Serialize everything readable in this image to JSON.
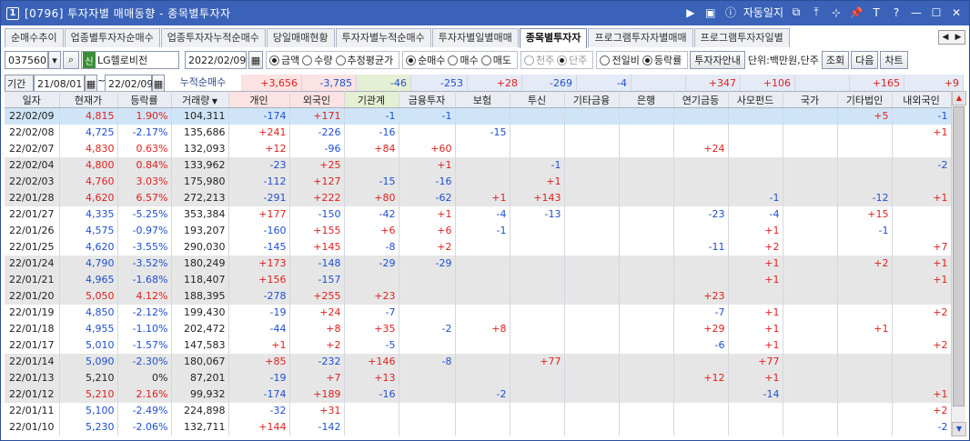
{
  "window": {
    "badge": "1",
    "title": "[0796] 투자자별 매매동향 - 종목별투자자",
    "alarm": "자동일지"
  },
  "tabs": [
    "순매수추이",
    "업종별투자자순매수",
    "업종투자자누적순매수",
    "당일매매현황",
    "투자자별누적순매수",
    "투자자별일별매매",
    "종목별투자자",
    "프로그램투자자별매매",
    "프로그램투자자일별"
  ],
  "active_tab": 6,
  "controls": {
    "code": "037560",
    "stock_name": "LG헬로비전",
    "date": "2022/02/09",
    "r1": [
      "금액",
      "수량",
      "추정평균가"
    ],
    "r2": [
      "순매수",
      "매수",
      "매도"
    ],
    "r3": [
      "천주",
      "단주"
    ],
    "r4": [
      "전일비",
      "등락률"
    ],
    "btn_info": "투자자안내",
    "unit": "단위:백만원,단주",
    "btn_query": "조회",
    "btn_next": "다음",
    "btn_chart": "차트"
  },
  "period": {
    "label": "기간",
    "from": "21/08/01",
    "tilde": "~",
    "to": "22/02/09",
    "cum_label": "누적순매수"
  },
  "summary": [
    "+3,656",
    "-3,785",
    "-46",
    "-253",
    "+28",
    "-269",
    "-4",
    "",
    "+347",
    "+106",
    "",
    "+165",
    "+9"
  ],
  "headers": [
    "일자",
    "현재가",
    "등락률",
    "거래량",
    "개인",
    "외국인",
    "기관계",
    "금융투자",
    "보험",
    "투신",
    "기타금융",
    "은행",
    "연기금등",
    "사모펀드",
    "국가",
    "기타법인",
    "내외국인"
  ],
  "rows": [
    [
      "22/02/09",
      "4,815",
      "1.90%",
      "104,311",
      "-174",
      "+171",
      "-1",
      "-1",
      "",
      "",
      "",
      "",
      "",
      "",
      "",
      "+5",
      "-1"
    ],
    [
      "22/02/08",
      "4,725",
      "-2.17%",
      "135,686",
      "+241",
      "-226",
      "-16",
      "",
      "-15",
      "",
      "",
      "",
      "",
      "",
      "",
      "",
      "+1"
    ],
    [
      "22/02/07",
      "4,830",
      "0.63%",
      "132,093",
      "+12",
      "-96",
      "+84",
      "+60",
      "",
      "",
      "",
      "",
      "+24",
      "",
      "",
      "",
      ""
    ],
    [
      "22/02/04",
      "4,800",
      "0.84%",
      "133,962",
      "-23",
      "+25",
      "",
      "+1",
      "",
      "-1",
      "",
      "",
      "",
      "",
      "",
      "",
      "-2"
    ],
    [
      "22/02/03",
      "4,760",
      "3.03%",
      "175,980",
      "-112",
      "+127",
      "-15",
      "-16",
      "",
      "+1",
      "",
      "",
      "",
      "",
      "",
      "",
      ""
    ],
    [
      "22/01/28",
      "4,620",
      "6.57%",
      "272,213",
      "-291",
      "+222",
      "+80",
      "-62",
      "+1",
      "+143",
      "",
      "",
      "",
      "-1",
      "",
      "-12",
      "+1"
    ],
    [
      "22/01/27",
      "4,335",
      "-5.25%",
      "353,384",
      "+177",
      "-150",
      "-42",
      "+1",
      "-4",
      "-13",
      "",
      "",
      "-23",
      "-4",
      "",
      "+15",
      ""
    ],
    [
      "22/01/26",
      "4,575",
      "-0.97%",
      "193,207",
      "-160",
      "+155",
      "+6",
      "+6",
      "-1",
      "",
      "",
      "",
      "",
      "+1",
      "",
      "-1",
      ""
    ],
    [
      "22/01/25",
      "4,620",
      "-3.55%",
      "290,030",
      "-145",
      "+145",
      "-8",
      "+2",
      "",
      "",
      "",
      "",
      "-11",
      "+2",
      "",
      "",
      "+7"
    ],
    [
      "22/01/24",
      "4,790",
      "-3.52%",
      "180,249",
      "+173",
      "-148",
      "-29",
      "-29",
      "",
      "",
      "",
      "",
      "",
      "+1",
      "",
      "+2",
      "+1"
    ],
    [
      "22/01/21",
      "4,965",
      "-1.68%",
      "118,407",
      "+156",
      "-157",
      "",
      "",
      "",
      "",
      "",
      "",
      "",
      "+1",
      "",
      "",
      "+1"
    ],
    [
      "22/01/20",
      "5,050",
      "4.12%",
      "188,395",
      "-278",
      "+255",
      "+23",
      "",
      "",
      "",
      "",
      "",
      "+23",
      "",
      "",
      "",
      ""
    ],
    [
      "22/01/19",
      "4,850",
      "-2.12%",
      "199,430",
      "-19",
      "+24",
      "-7",
      "",
      "",
      "",
      "",
      "",
      "-7",
      "+1",
      "",
      "",
      "+2"
    ],
    [
      "22/01/18",
      "4,955",
      "-1.10%",
      "202,472",
      "-44",
      "+8",
      "+35",
      "-2",
      "+8",
      "",
      "",
      "",
      "+29",
      "+1",
      "",
      "+1",
      ""
    ],
    [
      "22/01/17",
      "5,010",
      "-1.57%",
      "147,583",
      "+1",
      "+2",
      "-5",
      "",
      "",
      "",
      "",
      "",
      "-6",
      "+1",
      "",
      "",
      "+2"
    ],
    [
      "22/01/14",
      "5,090",
      "-2.30%",
      "180,067",
      "+85",
      "-232",
      "+146",
      "-8",
      "",
      "+77",
      "",
      "",
      "",
      "+77",
      "",
      "",
      ""
    ],
    [
      "22/01/13",
      "5,210",
      "0%",
      "87,201",
      "-19",
      "+7",
      "+13",
      "",
      "",
      "",
      "",
      "",
      "+12",
      "+1",
      "",
      "",
      ""
    ],
    [
      "22/01/12",
      "5,210",
      "2.16%",
      "99,932",
      "-174",
      "+189",
      "-16",
      "",
      "-2",
      "",
      "",
      "",
      "",
      "-14",
      "",
      "",
      "+1"
    ],
    [
      "22/01/11",
      "5,100",
      "-2.49%",
      "224,898",
      "-32",
      "+31",
      "",
      "",
      "",
      "",
      "",
      "",
      "",
      "",
      "",
      "",
      "+2"
    ],
    [
      "22/01/10",
      "5,230",
      "-2.06%",
      "132,711",
      "+144",
      "-142",
      "",
      "",
      "",
      "",
      "",
      "",
      "",
      "",
      "",
      "",
      "-2"
    ]
  ],
  "colors": {
    "up": "#e02020",
    "down": "#1f4fd1",
    "titlebar": "#3a62b8"
  }
}
